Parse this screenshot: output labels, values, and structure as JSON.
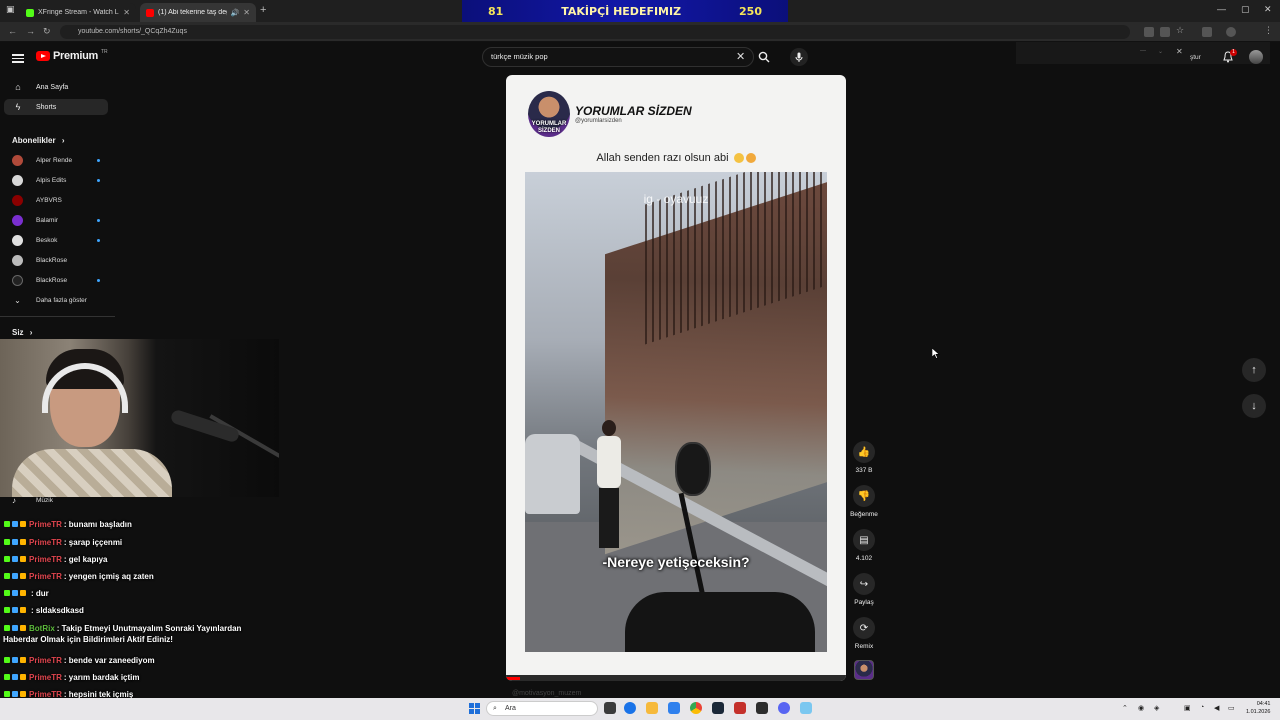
{
  "browser": {
    "tabs": [
      {
        "title": "XFringe Stream - Watch Live on",
        "color": "#53fc18"
      },
      {
        "title": "(1) Abi tekerine taş değmesin",
        "color": "#ff0000"
      }
    ],
    "url": "youtube.com/shorts/_QCqZh4Zuqs"
  },
  "stream_goal": {
    "current": "81",
    "label": "TAKİPÇİ HEDEFIMIZ",
    "target": "250"
  },
  "youtube": {
    "logo_text": "Premium",
    "logo_sup": "TR",
    "nav": [
      {
        "label": "Ana Sayfa",
        "icon": "home-icon"
      },
      {
        "label": "Shorts",
        "icon": "shorts-icon"
      }
    ],
    "subs_header": "Abonelikler",
    "subscriptions": [
      {
        "name": "Alper Rende",
        "color": "#b04a3a",
        "dot": true
      },
      {
        "name": "Alpis Edits",
        "color": "#d8d8d8",
        "dot": true
      },
      {
        "name": "AYBVRS",
        "color": "#8b0000",
        "dot": false
      },
      {
        "name": "Balamir",
        "color": "#7a2fd0",
        "dot": true
      },
      {
        "name": "Beskok",
        "color": "#e0e0e0",
        "dot": true
      },
      {
        "name": "BlackRose",
        "color": "#bbbbbb",
        "dot": false
      },
      {
        "name": "BlackRose",
        "color": "#222222",
        "dot": true
      }
    ],
    "show_more": "Daha fazla göster",
    "you_header": "Siz",
    "ghost_music": "Müzik",
    "search": {
      "value": "türkçe müzik pop"
    },
    "topright_text": "ştur",
    "bell_count": "1"
  },
  "chat": {
    "lines": [
      {
        "user": "PrimeTR",
        "msg": ": bunamı başladın",
        "color": "#e0454e"
      },
      {
        "user": "PrimeTR",
        "msg": ": şarap iççenmi",
        "color": "#e0454e"
      },
      {
        "user": "PrimeTR",
        "msg": ": gel kapıya",
        "color": "#e0454e"
      },
      {
        "user": "PrimeTR",
        "msg": ": yengen içmiş aq zaten",
        "color": "#e0454e"
      },
      {
        "user": "",
        "msg": ": dur",
        "color": "#e0454e"
      },
      {
        "user": "",
        "msg": ": sldaksdkasd",
        "color": "#e0454e"
      },
      {
        "user": "BotRix",
        "msg": ": Takip Etmeyi Unutmayalım Sonraki Yayınlardan",
        "color": "#5dbb3c"
      },
      {
        "user": "PrimeTR",
        "msg": ": bende var zaneediyom",
        "color": "#e0454e"
      },
      {
        "user": "PrimeTR",
        "msg": ": yarım bardak içtim",
        "color": "#e0454e"
      },
      {
        "user": "PrimeTR",
        "msg": ": hepsini tek içmiş",
        "color": "#e0454e"
      },
      {
        "user": "PrimeTR",
        "msg": "",
        "color": "#e0454e"
      }
    ],
    "wrap": "Haberdar Olmak için Bildirimleri Aktif Ediniz!"
  },
  "short": {
    "channel_name": "YORUMLAR SİZDEN",
    "channel_handle": "@yorumlarsizden",
    "avatar_tag": "YORUMLAR SİZDEN",
    "caption": "Allah senden razı olsun abi",
    "watermark": "ig - oyavuuz",
    "subtitle": "-Nereye yetişeceksin?",
    "progress": 0.04,
    "below_text": "@motivasyon_muzem"
  },
  "actions": [
    {
      "name": "like",
      "icon": "👍",
      "label": "337 B"
    },
    {
      "name": "dislike",
      "icon": "👎",
      "label": "Beğenme"
    },
    {
      "name": "comments",
      "icon": "▤",
      "label": "4.102"
    },
    {
      "name": "share",
      "icon": "↪",
      "label": "Paylaş"
    },
    {
      "name": "remix",
      "icon": "⟳",
      "label": "Remix"
    }
  ],
  "taskbar": {
    "search_label": "Ara",
    "time": "04:41",
    "date": "1.01.2026"
  }
}
